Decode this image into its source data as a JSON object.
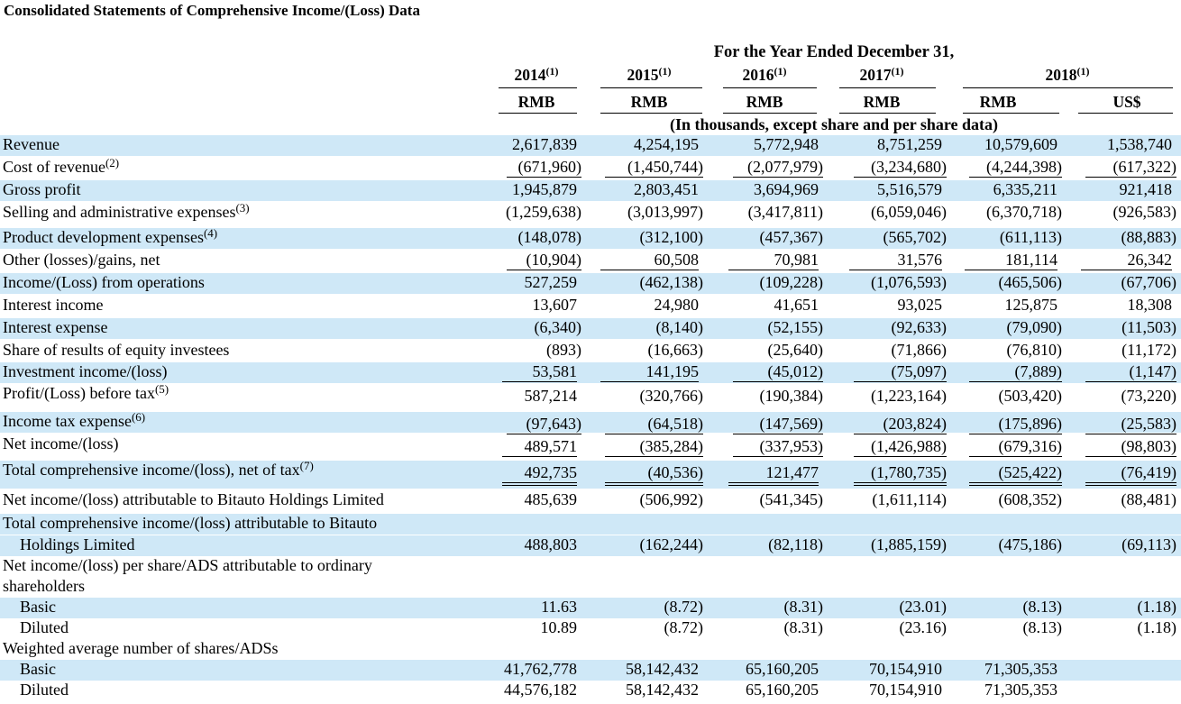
{
  "title": "Consolidated Statements of Comprehensive Income/(Loss) Data",
  "period_header": "For the Year Ended December 31,",
  "columns": [
    {
      "year": "2014",
      "note": "(1)",
      "currency": "RMB"
    },
    {
      "year": "2015",
      "note": "(1)",
      "currency": "RMB"
    },
    {
      "year": "2016",
      "note": "(1)",
      "currency": "RMB"
    },
    {
      "year": "2017",
      "note": "(1)",
      "currency": "RMB"
    },
    {
      "year": "2018",
      "note": "(1)",
      "currency": "RMB"
    },
    {
      "year": "",
      "note": "",
      "currency": "US$"
    }
  ],
  "subheader": "(In thousands, except share and per share data)",
  "rows": [
    {
      "label": "Revenue",
      "note": "",
      "values": [
        "2,617,839",
        "4,254,195",
        "5,772,948",
        "8,751,259",
        "10,579,609",
        "1,538,740"
      ]
    },
    {
      "label": "Cost of revenue",
      "note": "(2)",
      "values": [
        "(671,960)",
        "(1,450,744)",
        "(2,077,979)",
        "(3,234,680)",
        "(4,244,398)",
        "(617,322)"
      ]
    },
    {
      "label": "Gross profit",
      "note": "",
      "values": [
        "1,945,879",
        "2,803,451",
        "3,694,969",
        "5,516,579",
        "6,335,211",
        "921,418"
      ]
    },
    {
      "label": "Selling and administrative expenses",
      "note": "(3)",
      "values": [
        "(1,259,638)",
        "(3,013,997)",
        "(3,417,811)",
        "(6,059,046)",
        "(6,370,718)",
        "(926,583)"
      ]
    },
    {
      "label": "Product development expenses",
      "note": "(4)",
      "values": [
        "(148,078)",
        "(312,100)",
        "(457,367)",
        "(565,702)",
        "(611,113)",
        "(88,883)"
      ]
    },
    {
      "label": "Other (losses)/gains, net",
      "note": "",
      "values": [
        "(10,904)",
        "60,508",
        "70,981",
        "31,576",
        "181,114",
        "26,342"
      ]
    },
    {
      "label": "Income/(Loss) from operations",
      "note": "",
      "values": [
        "527,259",
        "(462,138)",
        "(109,228)",
        "(1,076,593)",
        "(465,506)",
        "(67,706)"
      ]
    },
    {
      "label": "Interest income",
      "note": "",
      "values": [
        "13,607",
        "24,980",
        "41,651",
        "93,025",
        "125,875",
        "18,308"
      ]
    },
    {
      "label": "Interest expense",
      "note": "",
      "values": [
        "(6,340)",
        "(8,140)",
        "(52,155)",
        "(92,633)",
        "(79,090)",
        "(11,503)"
      ]
    },
    {
      "label": "Share of results of equity investees",
      "note": "",
      "values": [
        "(893)",
        "(16,663)",
        "(25,640)",
        "(71,866)",
        "(76,810)",
        "(11,172)"
      ]
    },
    {
      "label": "Investment income/(loss)",
      "note": "",
      "values": [
        "53,581",
        "141,195",
        "(45,012)",
        "(75,097)",
        "(7,889)",
        "(1,147)"
      ]
    },
    {
      "label": "Profit/(Loss) before tax",
      "note": "(5)",
      "values": [
        "587,214",
        "(320,766)",
        "(190,384)",
        "(1,223,164)",
        "(503,420)",
        "(73,220)"
      ]
    },
    {
      "label": "Income tax expense",
      "note": "(6)",
      "values": [
        "(97,643)",
        "(64,518)",
        "(147,569)",
        "(203,824)",
        "(175,896)",
        "(25,583)"
      ]
    },
    {
      "label": "Net income/(loss)",
      "note": "",
      "values": [
        "489,571",
        "(385,284)",
        "(337,953)",
        "(1,426,988)",
        "(679,316)",
        "(98,803)"
      ]
    },
    {
      "label": "Total comprehensive income/(loss), net of tax",
      "note": "(7)",
      "values": [
        "492,735",
        "(40,536)",
        "121,477",
        "(1,780,735)",
        "(525,422)",
        "(76,419)"
      ]
    },
    {
      "label": "Net income/(loss) attributable to Bitauto Holdings Limited",
      "note": "",
      "values": [
        "485,639",
        "(506,992)",
        "(541,345)",
        "(1,611,114)",
        "(608,352)",
        "(88,481)"
      ]
    },
    {
      "label": "Total comprehensive income/(loss) attributable to Bitauto",
      "note": "",
      "values": [
        "",
        "",
        "",
        "",
        "",
        ""
      ]
    },
    {
      "label": "Holdings Limited",
      "note": "",
      "values": [
        "488,803",
        "(162,244)",
        "(82,118)",
        "(1,885,159)",
        "(475,186)",
        "(69,113)"
      ]
    },
    {
      "label": "Net income/(loss) per share/ADS attributable to ordinary",
      "note": "",
      "values": [
        "",
        "",
        "",
        "",
        "",
        ""
      ]
    },
    {
      "label": "shareholders",
      "note": "",
      "values": [
        "",
        "",
        "",
        "",
        "",
        ""
      ]
    },
    {
      "label": "Basic",
      "note": "",
      "values": [
        "11.63",
        "(8.72)",
        "(8.31)",
        "(23.01)",
        "(8.13)",
        "(1.18)"
      ]
    },
    {
      "label": "Diluted",
      "note": "",
      "values": [
        "10.89",
        "(8.72)",
        "(8.31)",
        "(23.16)",
        "(8.13)",
        "(1.18)"
      ]
    },
    {
      "label": "Weighted average number of shares/ADSs",
      "note": "",
      "values": [
        "",
        "",
        "",
        "",
        "",
        ""
      ]
    },
    {
      "label": "Basic",
      "note": "",
      "values": [
        "41,762,778",
        "58,142,432",
        "65,160,205",
        "70,154,910",
        "71,305,353",
        ""
      ]
    },
    {
      "label": "Diluted",
      "note": "",
      "values": [
        "44,576,182",
        "58,142,432",
        "65,160,205",
        "70,154,910",
        "71,305,353",
        ""
      ]
    }
  ]
}
